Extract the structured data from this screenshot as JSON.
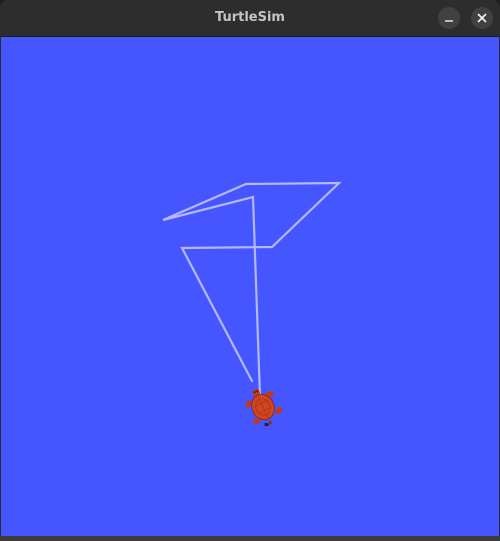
{
  "window": {
    "title": "TurtleSim"
  },
  "titlebar_buttons": {
    "minimize_icon": "minimize-icon",
    "close_icon": "close-icon"
  },
  "canvas": {
    "background_color": "#4556ff",
    "pen_color": "#b3b8ff"
  },
  "turtle": {
    "icon": "turtle-icon",
    "shell_color": "#d1461e",
    "limb_color": "#c0391b"
  }
}
